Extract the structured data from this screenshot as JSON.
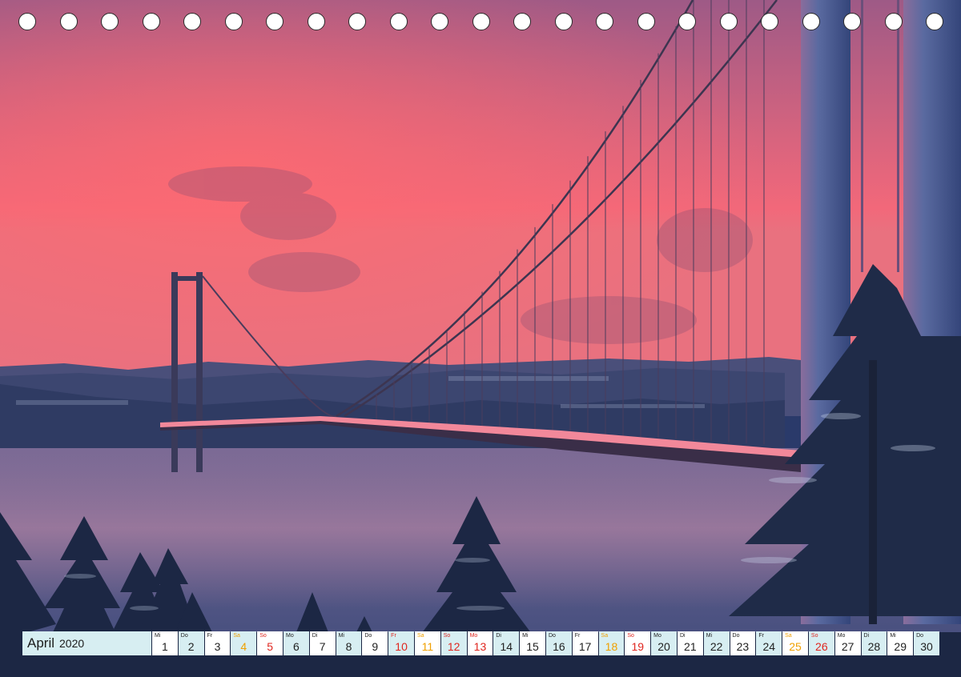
{
  "calendar": {
    "month": "April",
    "year": "2020",
    "days": [
      {
        "dow": "Mi",
        "num": "1",
        "type": "weekday"
      },
      {
        "dow": "Do",
        "num": "2",
        "type": "weekday"
      },
      {
        "dow": "Fr",
        "num": "3",
        "type": "weekday"
      },
      {
        "dow": "Sa",
        "num": "4",
        "type": "sat"
      },
      {
        "dow": "So",
        "num": "5",
        "type": "sun"
      },
      {
        "dow": "Mo",
        "num": "6",
        "type": "weekday"
      },
      {
        "dow": "Di",
        "num": "7",
        "type": "weekday"
      },
      {
        "dow": "Mi",
        "num": "8",
        "type": "weekday"
      },
      {
        "dow": "Do",
        "num": "9",
        "type": "weekday"
      },
      {
        "dow": "Fr",
        "num": "10",
        "type": "holiday"
      },
      {
        "dow": "Sa",
        "num": "11",
        "type": "sat"
      },
      {
        "dow": "So",
        "num": "12",
        "type": "sun"
      },
      {
        "dow": "Mo",
        "num": "13",
        "type": "holiday"
      },
      {
        "dow": "Di",
        "num": "14",
        "type": "weekday"
      },
      {
        "dow": "Mi",
        "num": "15",
        "type": "weekday"
      },
      {
        "dow": "Do",
        "num": "16",
        "type": "weekday"
      },
      {
        "dow": "Fr",
        "num": "17",
        "type": "weekday"
      },
      {
        "dow": "Sa",
        "num": "18",
        "type": "sat"
      },
      {
        "dow": "So",
        "num": "19",
        "type": "sun"
      },
      {
        "dow": "Mo",
        "num": "20",
        "type": "weekday"
      },
      {
        "dow": "Di",
        "num": "21",
        "type": "weekday"
      },
      {
        "dow": "Mi",
        "num": "22",
        "type": "weekday"
      },
      {
        "dow": "Do",
        "num": "23",
        "type": "weekday"
      },
      {
        "dow": "Fr",
        "num": "24",
        "type": "weekday"
      },
      {
        "dow": "Sa",
        "num": "25",
        "type": "sat"
      },
      {
        "dow": "So",
        "num": "26",
        "type": "sun"
      },
      {
        "dow": "Mo",
        "num": "27",
        "type": "weekday"
      },
      {
        "dow": "Di",
        "num": "28",
        "type": "weekday"
      },
      {
        "dow": "Mi",
        "num": "29",
        "type": "weekday"
      },
      {
        "dow": "Do",
        "num": "30",
        "type": "weekday"
      }
    ]
  },
  "binding": {
    "hole_count": 23
  },
  "colors": {
    "sky_top": "#b2648a",
    "sky_glow": "#f0667a",
    "water": "#53507a",
    "tower": "#4a5a8c",
    "saturday": "#f0a000",
    "sunday_holiday": "#e0261f",
    "cell_alt": "#d7eef2"
  },
  "photo": {
    "subject": "suspension-bridge-winter-sunrise"
  }
}
